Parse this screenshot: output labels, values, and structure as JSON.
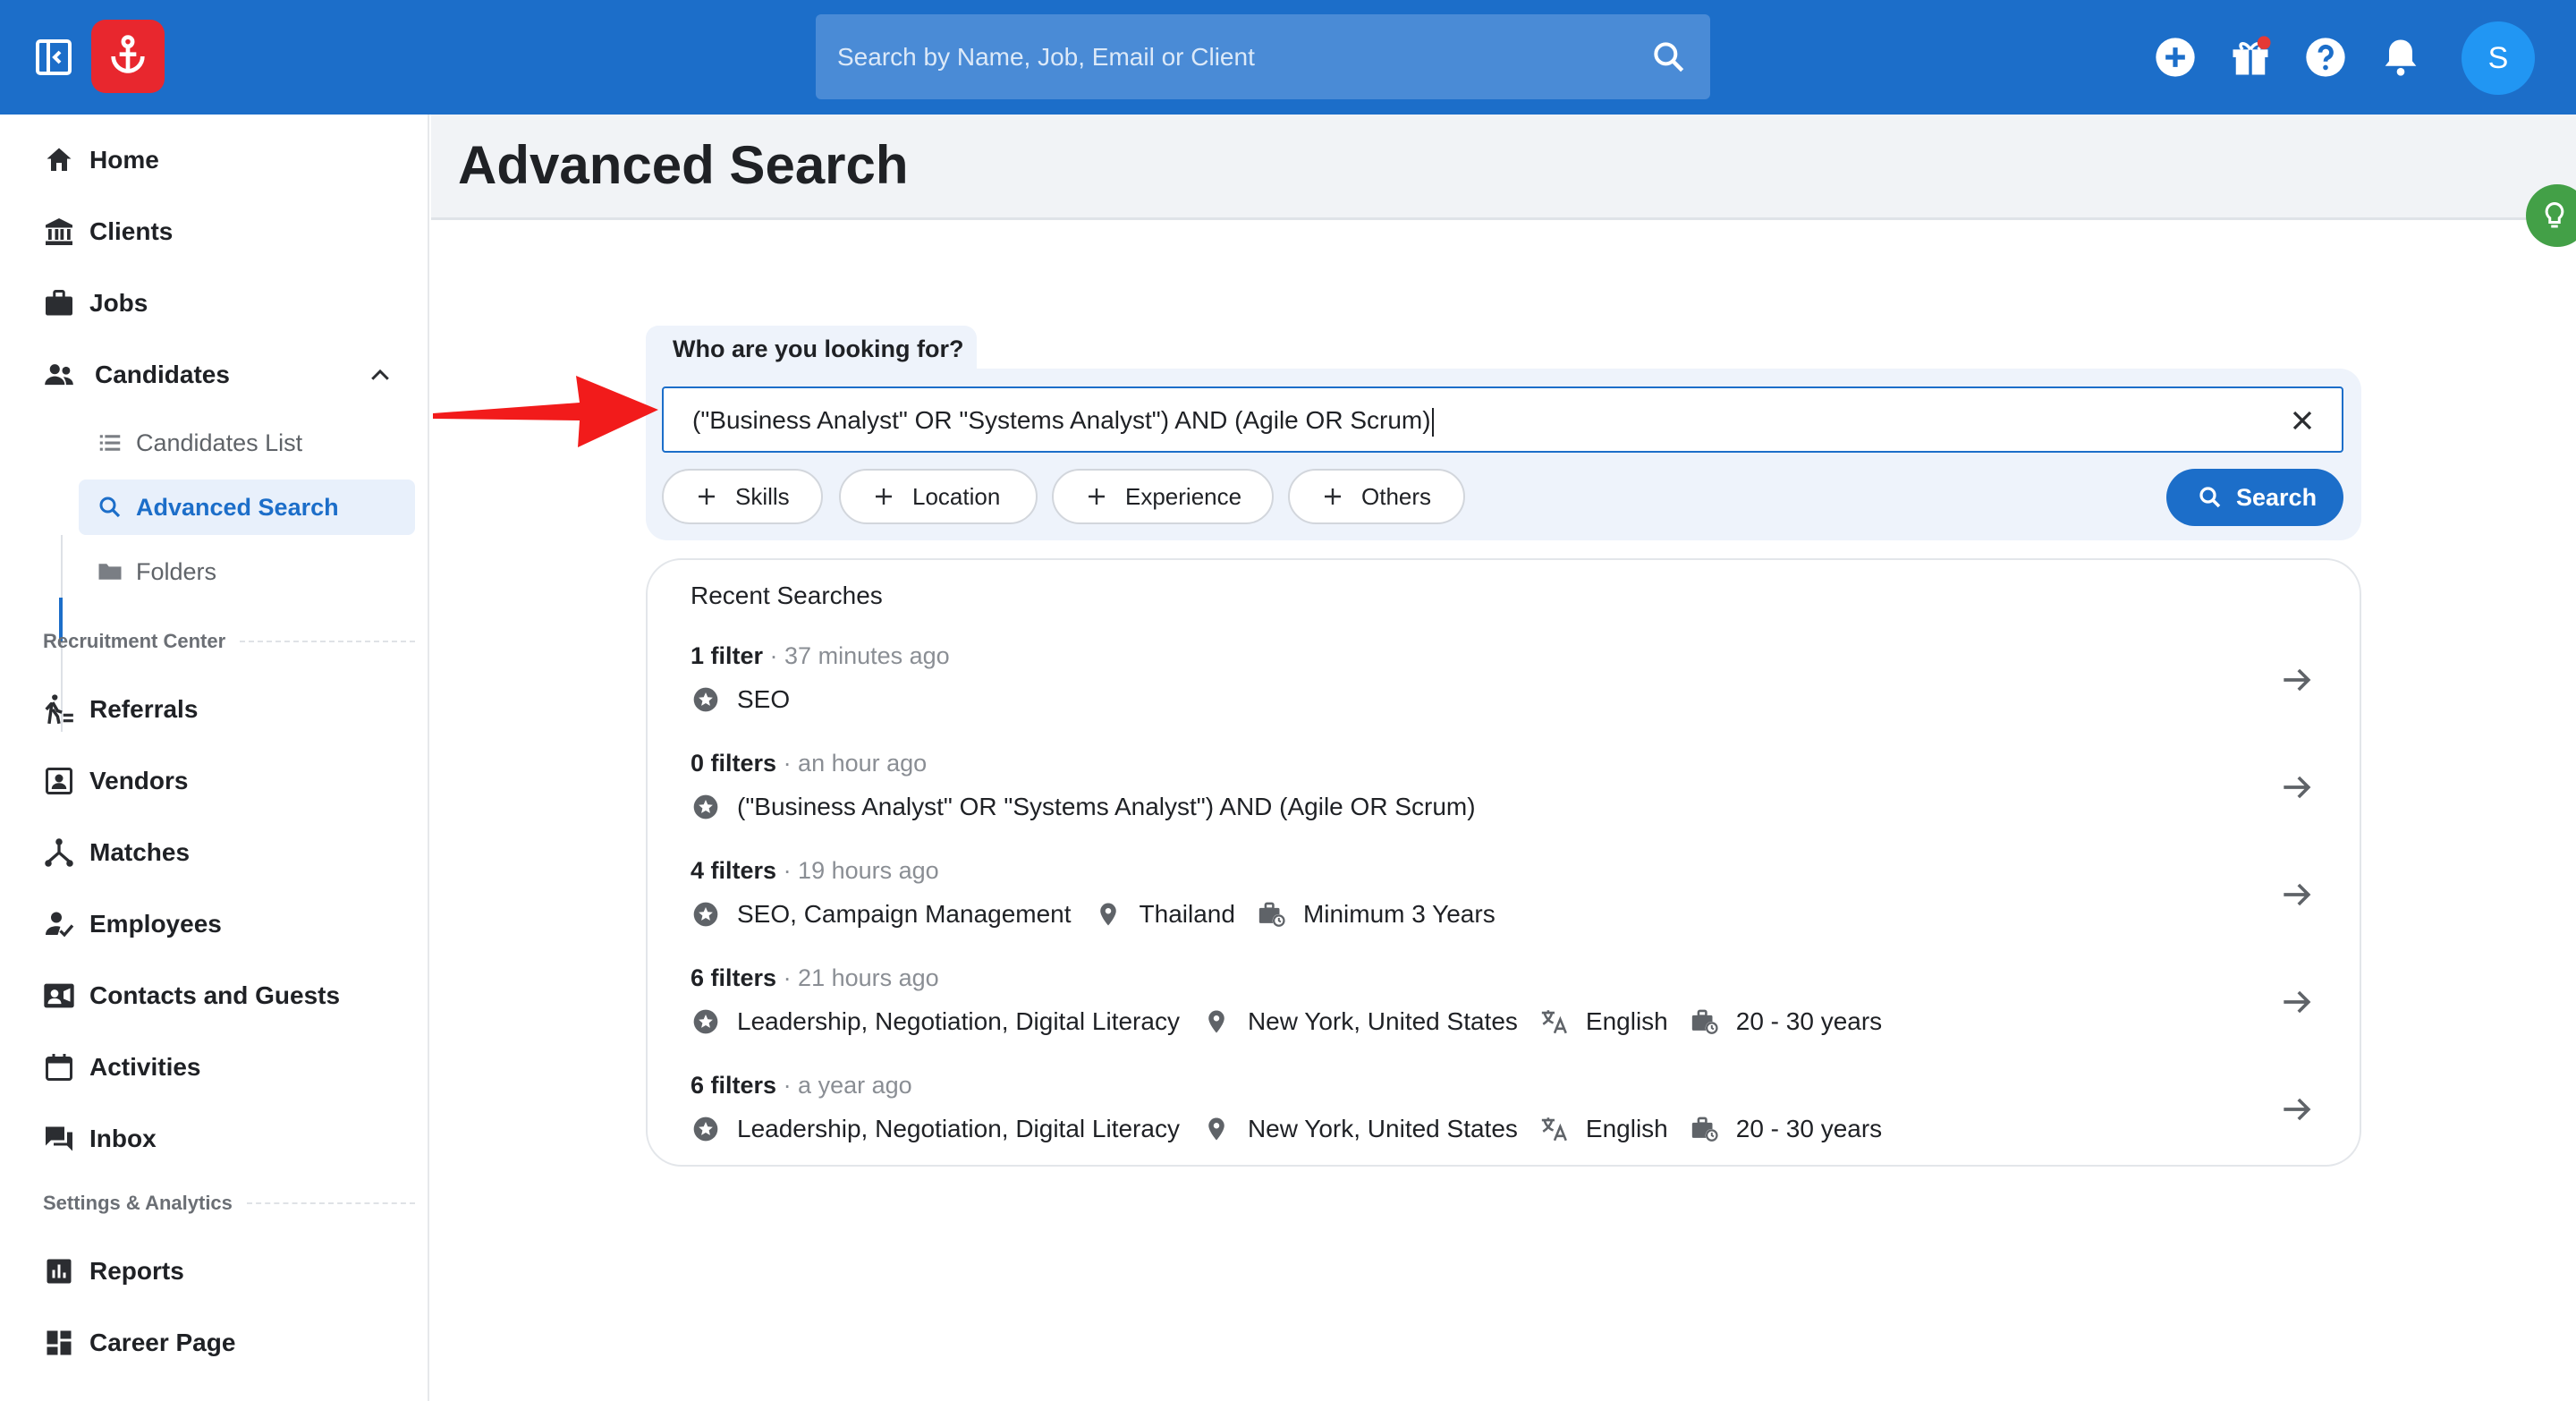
{
  "topbar": {
    "search_placeholder": "Search by Name, Job, Email or Client",
    "avatar_initial": "S",
    "brand_color": "#1c6ec9",
    "logo_color": "#e8272e"
  },
  "sidebar": {
    "home": "Home",
    "clients": "Clients",
    "jobs": "Jobs",
    "candidates": "Candidates",
    "candidates_list": "Candidates List",
    "advanced_search": "Advanced Search",
    "folders": "Folders",
    "section_recruitment": "Recruitment Center",
    "referrals": "Referrals",
    "vendors": "Vendors",
    "matches": "Matches",
    "employees": "Employees",
    "contacts": "Contacts and Guests",
    "activities": "Activities",
    "inbox": "Inbox",
    "section_settings": "Settings & Analytics",
    "reports": "Reports",
    "career_page": "Career Page"
  },
  "main": {
    "title": "Advanced Search",
    "question": "Who are you looking for?",
    "query": "(\"Business Analyst\" OR \"Systems Analyst\") AND (Agile OR Scrum)",
    "chips": {
      "skills": "Skills",
      "location": "Location",
      "experience": "Experience",
      "others": "Others"
    },
    "search_button": "Search"
  },
  "recent": {
    "title": "Recent Searches",
    "rows": [
      {
        "count": "1 filter",
        "time": "· 37 minutes ago",
        "skills": "SEO"
      },
      {
        "count": "0 filters",
        "time": "· an hour ago",
        "skills": "(\"Business Analyst\" OR \"Systems Analyst\") AND (Agile OR Scrum)"
      },
      {
        "count": "4 filters",
        "time": "· 19 hours ago",
        "skills": "SEO, Campaign Management",
        "location": "Thailand",
        "experience": "Minimum 3 Years"
      },
      {
        "count": "6 filters",
        "time": "· 21 hours ago",
        "skills": "Leadership, Negotiation, Digital Literacy",
        "location": "New York, United States",
        "language": "English",
        "experience": "20 - 30 years"
      },
      {
        "count": "6 filters",
        "time": "· a year ago",
        "skills": "Leadership, Negotiation, Digital Literacy",
        "location": "New York, United States",
        "language": "English",
        "experience": "20 - 30 years"
      }
    ]
  }
}
